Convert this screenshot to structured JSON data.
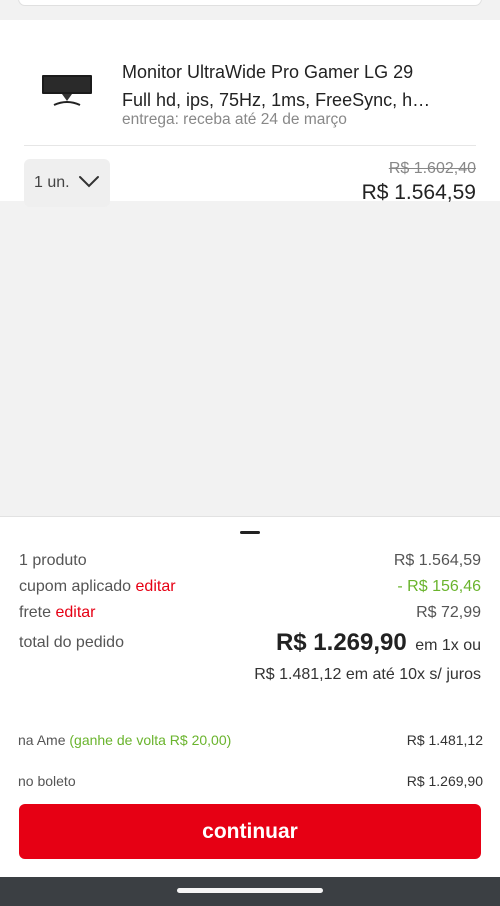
{
  "product": {
    "title_line1": "Monitor UltraWide Pro Gamer LG 29",
    "title_line2": "Full hd, ips, 75Hz, 1ms, FreeSync, h…",
    "delivery": "entrega: receba até 24 de março",
    "quantity": "1 un.",
    "old_price": "R$ 1.602,40",
    "price": "R$ 1.564,59",
    "thumbnail_icon": "ultrawide-monitor-image"
  },
  "summary": {
    "products_label": "1 produto",
    "products_value": "R$ 1.564,59",
    "coupon_label": "cupom aplicado",
    "coupon_edit": "editar",
    "coupon_value": "- R$ 156,46",
    "shipping_label": "frete",
    "shipping_edit": "editar",
    "shipping_value": "R$ 72,99",
    "total_label": "total do pedido",
    "total_value": "R$ 1.269,90",
    "total_suffix": "em 1x ou",
    "installments": "R$ 1.481,12 em até 10x s/ juros"
  },
  "payment_options": [
    {
      "label": "na Ame",
      "bonus": "(ganhe de volta R$ 20,00)",
      "value": "R$ 1.481,12"
    },
    {
      "label": "no boleto",
      "bonus": "",
      "value": "R$ 1.269,90"
    }
  ],
  "continue_label": "continuar",
  "colors": {
    "brand_red": "#e60014",
    "discount_green": "#6ab42d",
    "nav_bar": "#3b3f43"
  }
}
